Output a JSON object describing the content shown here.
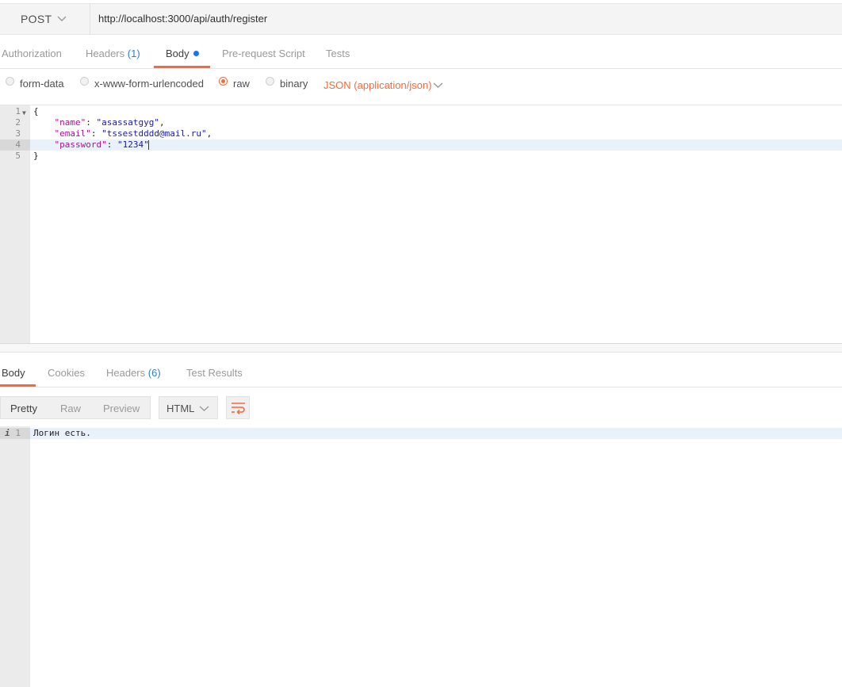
{
  "request": {
    "method": "POST",
    "url": "http://localhost:3000/api/auth/register"
  },
  "request_tabs": [
    {
      "label": "Authorization"
    },
    {
      "label": "Headers",
      "count": "(1)"
    },
    {
      "label": "Body",
      "modified": true
    },
    {
      "label": "Pre-request Script"
    },
    {
      "label": "Tests"
    }
  ],
  "body_modes": [
    {
      "label": "form-data",
      "selected": false
    },
    {
      "label": "x-www-form-urlencoded",
      "selected": false
    },
    {
      "label": "raw",
      "selected": true
    },
    {
      "label": "binary",
      "selected": false
    }
  ],
  "content_type": "JSON (application/json)",
  "editor": {
    "line_numbers": [
      "1",
      "2",
      "3",
      "4",
      "5"
    ],
    "lines": [
      {
        "text": "{"
      },
      {
        "key": "\"name\"",
        "value": "\"asassatgyg\"",
        "trail": ","
      },
      {
        "key": "\"email\"",
        "value": "\"tssestdddd@mail.ru\"",
        "trail": ","
      },
      {
        "key": "\"password\"",
        "value": "\"1234\"",
        "trail": ""
      },
      {
        "text": "}"
      }
    ]
  },
  "response_tabs": [
    {
      "label": "Body"
    },
    {
      "label": "Cookies"
    },
    {
      "label": "Headers",
      "count": "(6)"
    },
    {
      "label": "Test Results"
    }
  ],
  "response_view": {
    "modes": [
      "Pretty",
      "Raw",
      "Preview"
    ],
    "selected_mode": "Pretty",
    "language": "HTML"
  },
  "response_body": {
    "info_marker": "i",
    "line_number": "1",
    "text": "Логин есть."
  },
  "colors": {
    "accent": "#f26b3a",
    "count_blue": "#2c80d0",
    "modified_dot": "#1a73e8",
    "json_key": "#a31590",
    "json_string": "#1a1aa6"
  },
  "icons": [
    "chevron-down-icon",
    "wrap-lines-icon",
    "info-icon",
    "fold-arrow-icon"
  ]
}
